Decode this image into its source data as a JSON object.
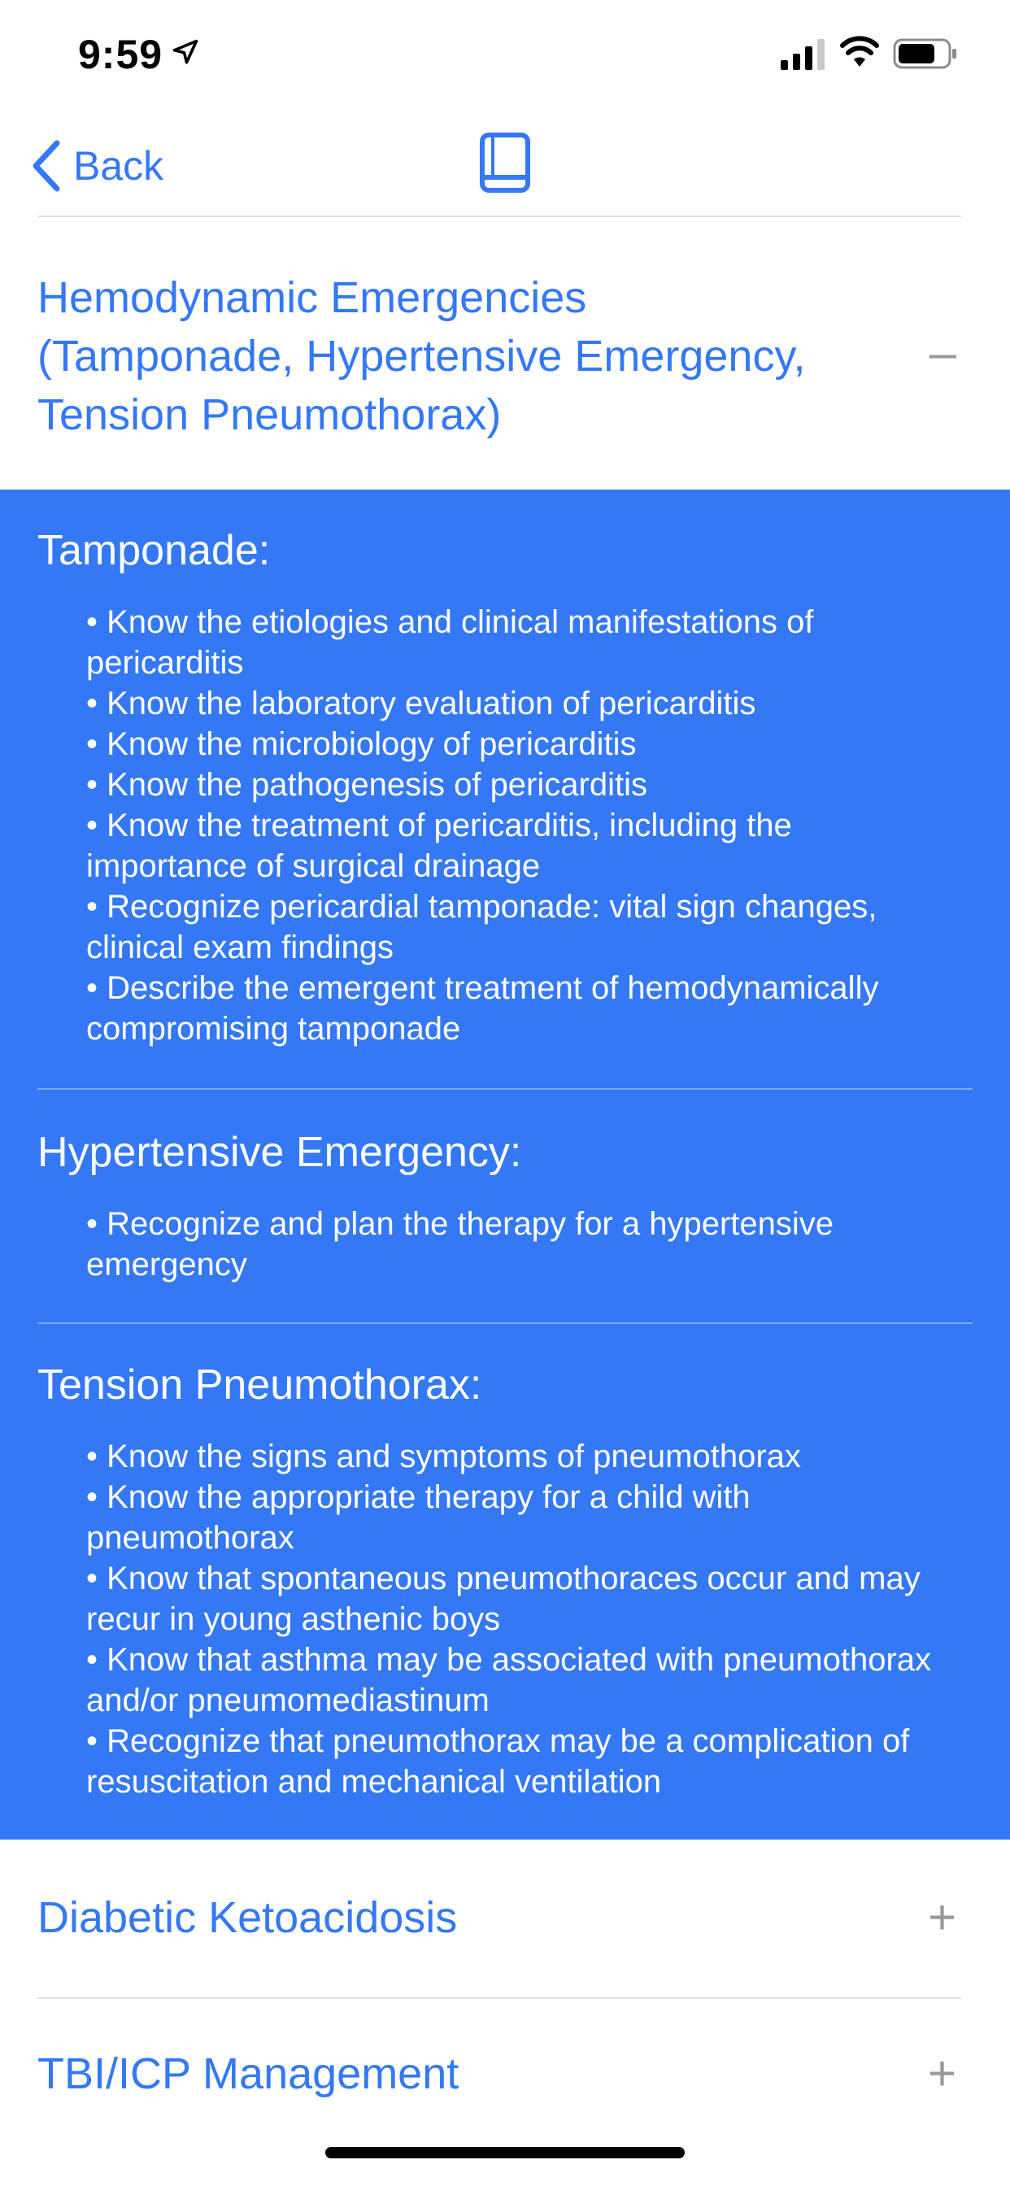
{
  "status_bar": {
    "time": "9:59",
    "icons": [
      "location-arrow-icon",
      "cellular-signal-icon",
      "wifi-icon",
      "battery-icon"
    ]
  },
  "nav": {
    "back_label": "Back",
    "center_icon": "book-icon"
  },
  "colors": {
    "accent": "#3478f6",
    "panel_background": "#3478f6",
    "toggle_gray": "#9a9a9a"
  },
  "expanded_section": {
    "title_lines": [
      "Hemodynamic Emergencies",
      "(Tamponade, Hypertensive Emergency,",
      "Tension Pneumothorax)"
    ],
    "toggle": "–",
    "subsections": [
      {
        "title": "Tamponade:",
        "bullets": [
          "• Know the etiologies and clinical manifestations of pericarditis",
          "• Know the laboratory evaluation of pericarditis",
          "• Know the microbiology of pericarditis",
          "• Know the pathogenesis of pericarditis",
          "• Know the treatment of pericarditis, including the importance of surgical drainage",
          "• Recognize pericardial tamponade: vital sign changes, clinical exam findings",
          "• Describe the emergent treatment of hemodynamically compromising tamponade"
        ]
      },
      {
        "title": "Hypertensive Emergency:",
        "bullets": [
          "• Recognize and plan the therapy for a hypertensive emergency"
        ]
      },
      {
        "title": "Tension Pneumothorax:",
        "bullets": [
          "• Know the signs and symptoms of pneumothorax",
          "• Know the appropriate therapy for a child with pneumothorax",
          "• Know that spontaneous pneumothoraces occur and may recur in young asthenic boys",
          "• Know that asthma may be associated with pneumothorax and/or pneumomediastinum",
          "• Recognize that pneumothorax may be a complication of resuscitation and mechanical ventilation"
        ]
      }
    ]
  },
  "collapsed_sections": [
    {
      "title": "Diabetic Ketoacidosis",
      "toggle": "+"
    },
    {
      "title": "TBI/ICP Management",
      "toggle": "+"
    }
  ]
}
